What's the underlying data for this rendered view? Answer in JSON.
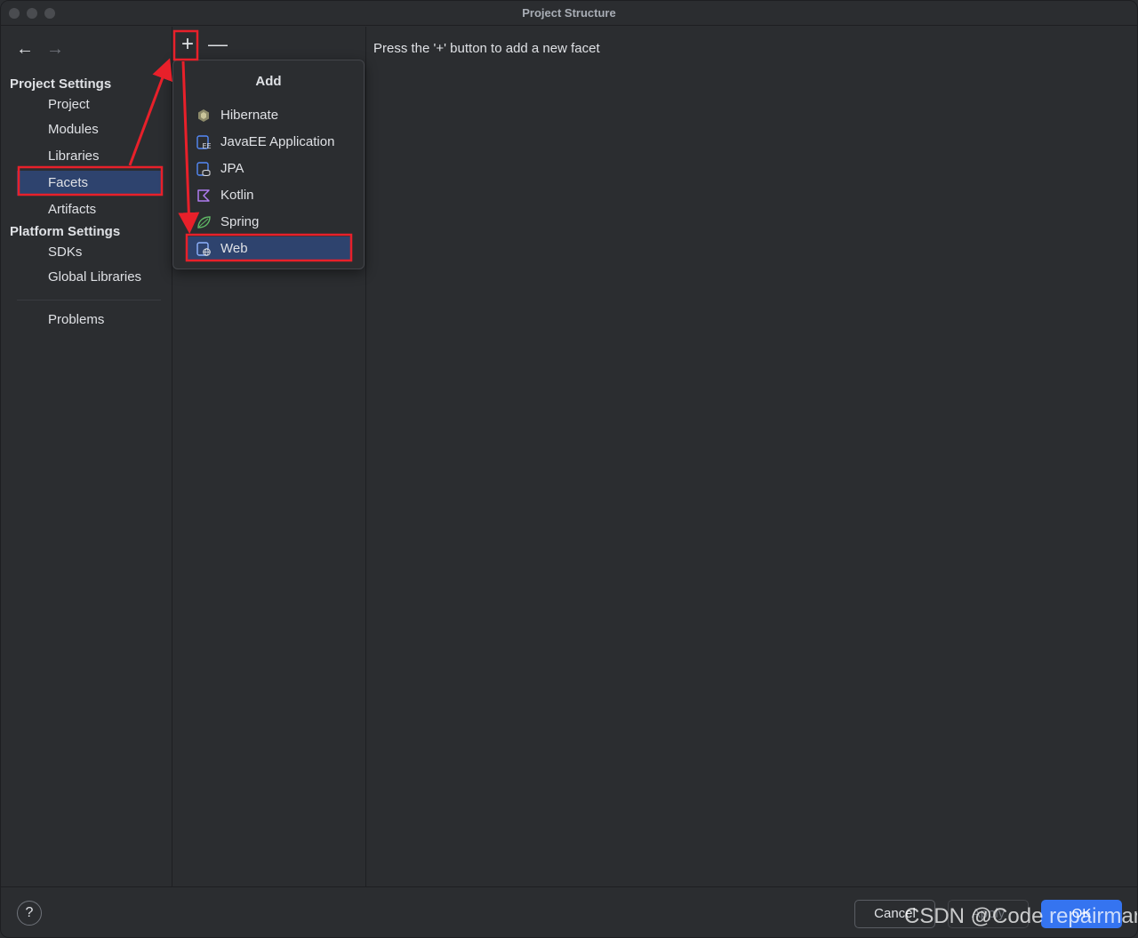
{
  "window": {
    "title": "Project Structure"
  },
  "sidebar": {
    "back_glyph": "←",
    "forward_glyph": "→",
    "project_settings_header": "Project Settings",
    "platform_settings_header": "Platform Settings",
    "project_items": [
      {
        "label": "Project"
      },
      {
        "label": "Modules"
      },
      {
        "label": "Libraries"
      },
      {
        "label": "Facets",
        "selected": true
      },
      {
        "label": "Artifacts"
      }
    ],
    "platform_items": [
      {
        "label": "SDKs"
      },
      {
        "label": "Global Libraries"
      }
    ],
    "problems_label": "Problems"
  },
  "toolbar": {
    "add_glyph": "+",
    "remove_glyph": "—"
  },
  "content": {
    "hint": "Press the '+' button to add a new facet"
  },
  "popup": {
    "title": "Add",
    "items": [
      {
        "label": "Hibernate",
        "icon": "hibernate-icon"
      },
      {
        "label": "JavaEE Application",
        "icon": "javaee-icon"
      },
      {
        "label": "JPA",
        "icon": "jpa-icon"
      },
      {
        "label": "Kotlin",
        "icon": "kotlin-icon"
      },
      {
        "label": "Spring",
        "icon": "spring-icon"
      },
      {
        "label": "Web",
        "icon": "web-icon",
        "selected": true
      }
    ]
  },
  "footer": {
    "help": "?",
    "cancel": "Cancel",
    "apply": "Apply",
    "ok": "OK"
  },
  "watermark": "CSDN @Code repairman",
  "colors": {
    "background": "#2b2d30",
    "selection": "#2e436e",
    "primary_button": "#3574f0",
    "annotation_red": "#e8202a"
  }
}
